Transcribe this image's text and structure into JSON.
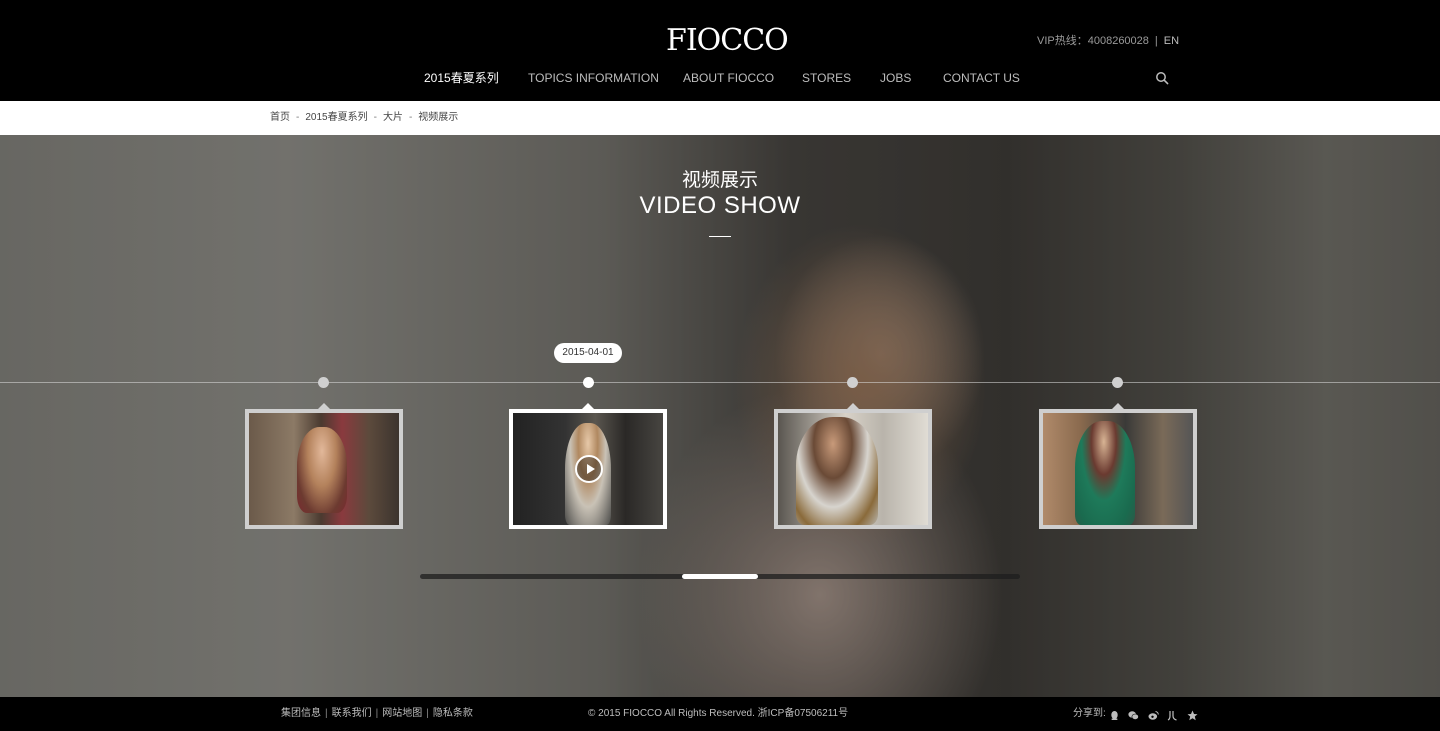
{
  "header": {
    "logo": "FIOCCO",
    "vip_hotline": "VIP热线：4008260028",
    "separator": "|",
    "lang": "EN",
    "nav": [
      {
        "label": "2015春夏系列",
        "active": true
      },
      {
        "label": "TOPICS INFORMATION",
        "active": false
      },
      {
        "label": "ABOUT FIOCCO",
        "active": false
      },
      {
        "label": "STORES",
        "active": false
      },
      {
        "label": "JOBS",
        "active": false
      },
      {
        "label": "CONTACT US",
        "active": false
      }
    ],
    "search_icon": "search-icon"
  },
  "breadcrumb": {
    "items": [
      "首页",
      "2015春夏系列",
      "大片",
      "视频展示"
    ],
    "separator": "-"
  },
  "section": {
    "title_cn": "视频展示",
    "title_en": "VIDEO SHOW"
  },
  "timeline": {
    "active_date": "2015-04-01",
    "active_index": 1,
    "items": [
      {
        "thumb": "woman-red-dress"
      },
      {
        "thumb": "woman-beige-jacket-video"
      },
      {
        "thumb": "woman-fur-coat"
      },
      {
        "thumb": "woman-green-dress"
      }
    ],
    "play_icon": "play-icon",
    "scroll_position": 0.5
  },
  "footer": {
    "links": [
      "集团信息",
      "联系我们",
      "网站地图",
      "隐私条款"
    ],
    "link_separator": "|",
    "copyright": "© 2015 FIOCCO All Rights Reserved.  浙ICP备07506211号",
    "share_label": "分享到:",
    "share_icons": [
      "qq-icon",
      "wechat-icon",
      "weibo-icon",
      "renren-icon",
      "star-icon"
    ]
  },
  "colors": {
    "header_bg": "#000000",
    "breadcrumb_bg": "#ffffff",
    "accent": "#ffffff"
  }
}
